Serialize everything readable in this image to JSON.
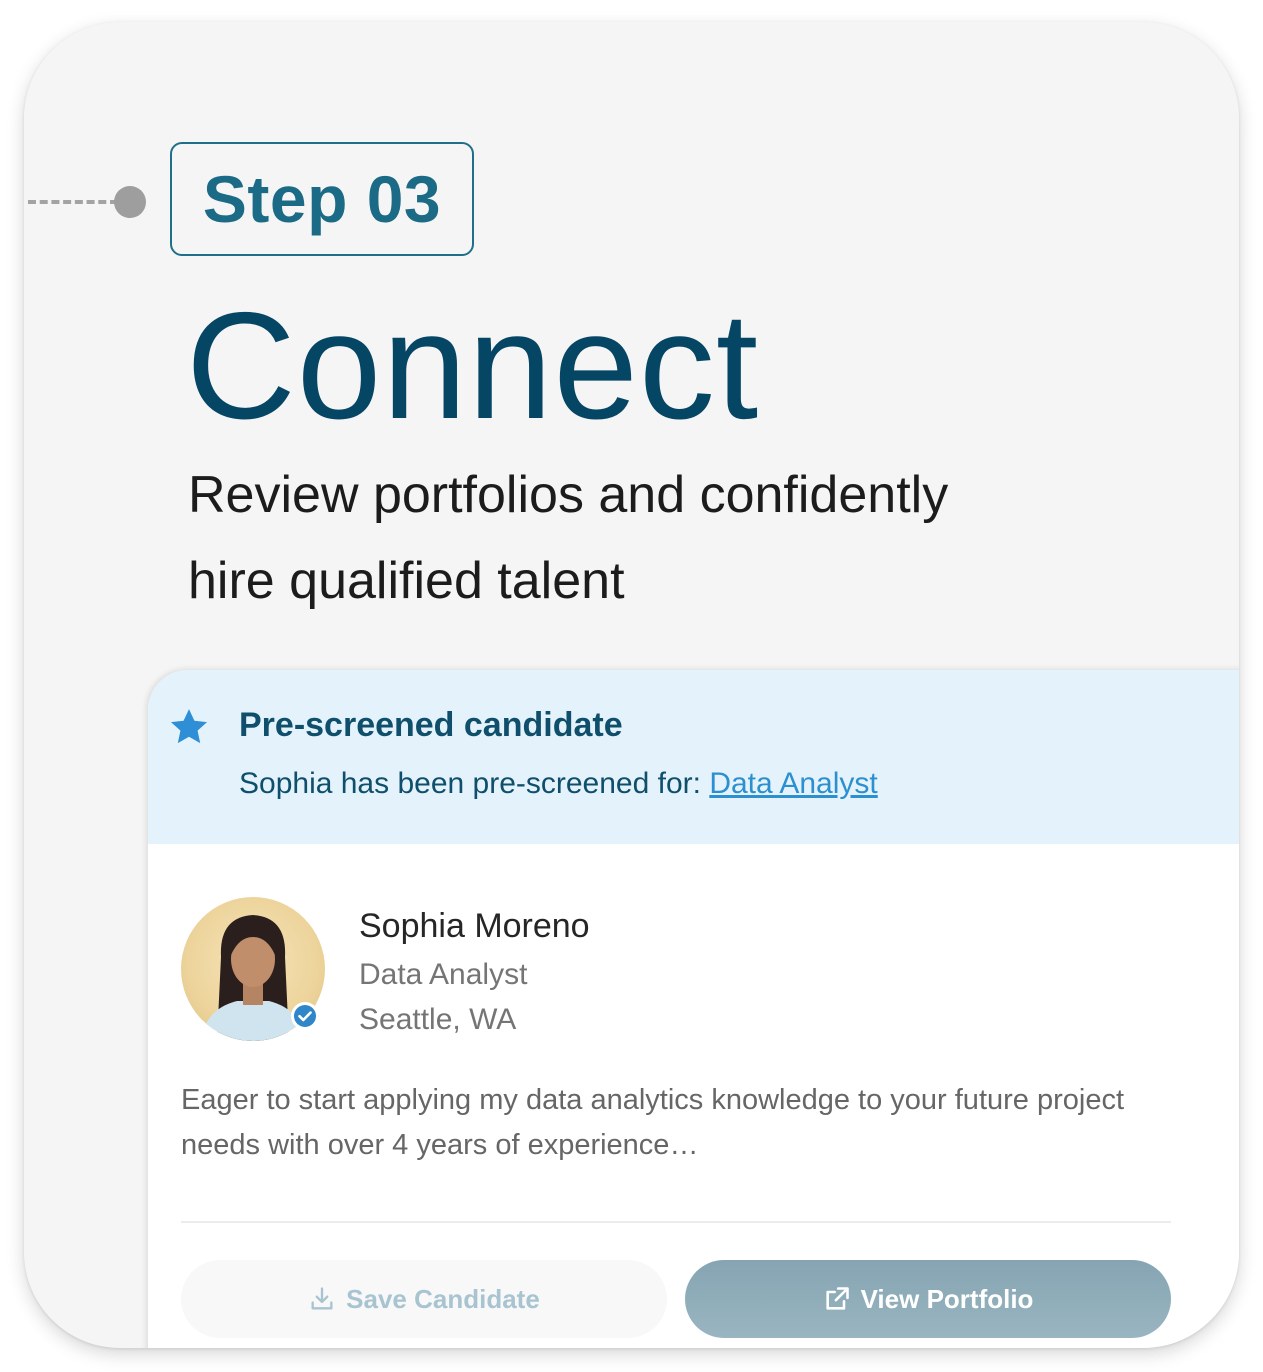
{
  "step": {
    "badge_label": "Step 03"
  },
  "header": {
    "title": "Connect",
    "subtitle_line1": "Review portfolios and confidently",
    "subtitle_line2": "hire qualified talent"
  },
  "banner": {
    "icon": "star-icon",
    "title": "Pre-screened candidate",
    "text": "Sophia has been pre-screened for:",
    "link_label": "Data Analyst"
  },
  "candidate": {
    "name": "Sophia Moreno",
    "role": "Data Analyst",
    "location": "Seattle, WA",
    "bio": "Eager to start applying my data analytics knowledge to your future project needs with over 4 years of experience…",
    "verified_icon": "verified-check-icon"
  },
  "actions": {
    "save_label": "Save Candidate",
    "save_icon": "download-icon",
    "view_label": "View Portfolio",
    "view_icon": "external-link-icon"
  },
  "colors": {
    "title": "#064665",
    "accent": "#1b6a86",
    "link": "#2c8fcf",
    "banner_bg": "#e4f3fb",
    "view_button": "#8fabb8"
  }
}
